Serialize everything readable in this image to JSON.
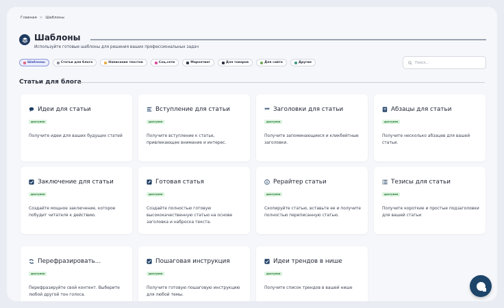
{
  "breadcrumb": {
    "home": "Главная",
    "separator": ">",
    "current": "Шаблоны"
  },
  "header": {
    "title": "Шаблоны",
    "subtitle": "Используйте готовые шаблоны для решения ваших профессиональных задач"
  },
  "filters": [
    {
      "label": "Шаблоны",
      "icon": "chart-icon",
      "active": true
    },
    {
      "label": "Статьи для блога",
      "icon": "article-icon",
      "active": false
    },
    {
      "label": "Написание текстов",
      "icon": "pencil-icon",
      "active": false
    },
    {
      "label": "Соц.сети",
      "icon": "social-icon",
      "active": false
    },
    {
      "label": "Маркетинг",
      "icon": "phone-icon",
      "active": false
    },
    {
      "label": "Для товаров",
      "icon": "product-icon",
      "active": false
    },
    {
      "label": "Для сайта",
      "icon": "globe-icon",
      "active": false
    },
    {
      "label": "Другие",
      "icon": "other-icon",
      "active": false
    }
  ],
  "search": {
    "placeholder": "Поиск..."
  },
  "section": {
    "title": "Статьи для блога"
  },
  "badge_label": "доступен",
  "cards": [
    {
      "title": "Идеи для статьи",
      "icon": "speech-bubble-icon",
      "description": "Получите идеи для ваших будущих статей"
    },
    {
      "title": "Вступление для статьи",
      "icon": "lines-icon",
      "description": "Получите вступление к статье, привлекающее внимание и интерес."
    },
    {
      "title": "Заголовки для статьи",
      "icon": "quote-icon",
      "description": "Получите запоминающиеся и кликбейтные заголовки."
    },
    {
      "title": "Абзацы для статьи",
      "icon": "document-icon",
      "description": "Получите несколько абзацев для вашей статьи."
    },
    {
      "title": "Заключение для статьи",
      "icon": "checkbox-icon",
      "description": "Создайте мощное заключение, которое побудит читателя к действию."
    },
    {
      "title": "Готовая статья",
      "icon": "edit-icon",
      "description": "Создайте полностью готовую высококачественную статью на основе заголовка и наброска текста."
    },
    {
      "title": "Рерайтер статьи",
      "icon": "info-icon",
      "description": "Скопируйте статью, вставьте ее и получите полностью переписанную статью."
    },
    {
      "title": "Тезисы для статьи",
      "icon": "list-icon",
      "description": "Получите короткие и простые подзаголовки для вашей статьи"
    },
    {
      "title": "Перефразировать...",
      "icon": "refresh-icon",
      "description": "Перефразируйте свой контент. Выберите любой другой тон голоса."
    },
    {
      "title": "Пошаговая инструкция",
      "icon": "checkbox-icon",
      "description": "Получите готовую пошаговую инструкцию для любой темы."
    },
    {
      "title": "Идеи трендов в нише",
      "icon": "checkbox-icon",
      "description": "Получите список трендов в вашей нише"
    }
  ],
  "colors": {
    "accent": "#1d4469",
    "badge_bg": "#d9f2dc",
    "badge_text": "#2b7a3a",
    "chip_active": "#3b4bb0"
  }
}
